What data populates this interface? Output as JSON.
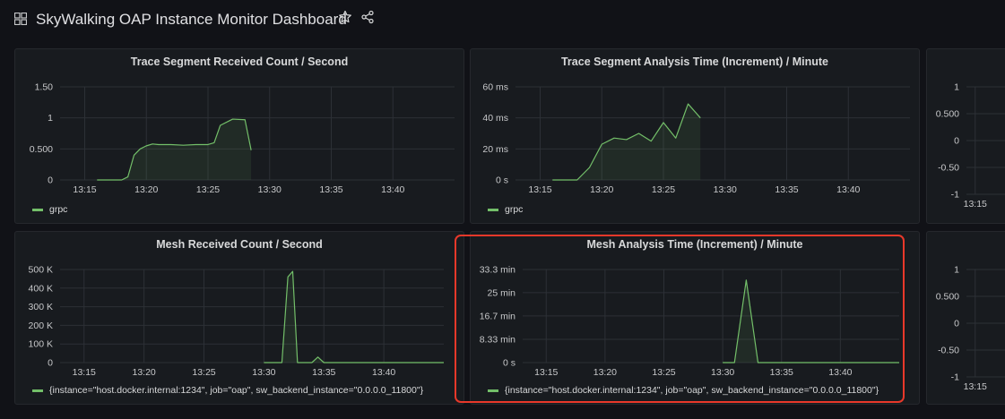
{
  "header": {
    "title": "SkyWalking OAP Instance Monitor Dashboard",
    "icons": [
      "dashboard-grid-icon",
      "star-icon",
      "share-icon"
    ]
  },
  "colors": {
    "series": "#73bf69",
    "highlight": "#e8382a",
    "panel_bg": "#181b1f",
    "page_bg": "#111217"
  },
  "chart_data": [
    {
      "id": "trace-received",
      "type": "area",
      "title": "Trace Segment Received Count / Second",
      "x_ticks": [
        "13:15",
        "13:20",
        "13:25",
        "13:30",
        "13:35",
        "13:40"
      ],
      "y_ticks": [
        "1.50",
        "1",
        "0.500",
        "0"
      ],
      "ylim": [
        0,
        1.5
      ],
      "xlim": [
        "13:13",
        "13:45"
      ],
      "series": [
        {
          "name": "grpc",
          "x": [
            "13:16",
            "13:18",
            "13:18.5",
            "13:19",
            "13:19.5",
            "13:20",
            "13:20.5",
            "13:21",
            "13:22",
            "13:23",
            "13:24",
            "13:25",
            "13:25.5",
            "13:26",
            "13:27",
            "13:28",
            "13:28.5"
          ],
          "y": [
            0,
            0,
            0.05,
            0.4,
            0.5,
            0.55,
            0.58,
            0.57,
            0.57,
            0.56,
            0.57,
            0.57,
            0.6,
            0.88,
            0.98,
            0.97,
            0.48
          ]
        }
      ]
    },
    {
      "id": "trace-analysis",
      "type": "area",
      "title": "Trace Segment Analysis Time (Increment) / Minute",
      "x_ticks": [
        "13:15",
        "13:20",
        "13:25",
        "13:30",
        "13:35",
        "13:40"
      ],
      "y_ticks": [
        "60 ms",
        "40 ms",
        "20 ms",
        "0 s"
      ],
      "ylim": [
        0,
        60
      ],
      "xlim": [
        "13:13",
        "13:45"
      ],
      "series": [
        {
          "name": "grpc",
          "x": [
            "13:16",
            "13:18",
            "13:19",
            "13:20",
            "13:21",
            "13:22",
            "13:23",
            "13:24",
            "13:25",
            "13:26",
            "13:27",
            "13:28"
          ],
          "y": [
            0,
            0,
            8,
            23,
            27,
            26,
            30,
            25,
            37,
            27,
            49,
            40
          ]
        }
      ]
    },
    {
      "id": "mesh-received",
      "type": "area",
      "title": "Mesh Received Count / Second",
      "x_ticks": [
        "13:15",
        "13:20",
        "13:25",
        "13:30",
        "13:35",
        "13:40"
      ],
      "y_ticks": [
        "500 K",
        "400 K",
        "300 K",
        "200 K",
        "100 K",
        "0"
      ],
      "ylim": [
        0,
        500000
      ],
      "xlim": [
        "13:13",
        "13:45"
      ],
      "series": [
        {
          "name": "{instance=\"host.docker.internal:1234\", job=\"oap\", sw_backend_instance=\"0.0.0.0_11800\"}",
          "x": [
            "13:30",
            "13:31.5",
            "13:32",
            "13:32.4",
            "13:32.8",
            "13:34",
            "13:34.5",
            "13:35",
            "13:36",
            "13:45"
          ],
          "y": [
            0,
            0,
            460000,
            490000,
            0,
            0,
            30000,
            0,
            0,
            0
          ]
        }
      ]
    },
    {
      "id": "mesh-analysis",
      "type": "area",
      "title": "Mesh Analysis Time (Increment) / Minute",
      "x_ticks": [
        "13:15",
        "13:20",
        "13:25",
        "13:30",
        "13:35",
        "13:40"
      ],
      "y_ticks": [
        "33.3 min",
        "25 min",
        "16.7 min",
        "8.33 min",
        "0 s"
      ],
      "ylim": [
        0,
        33.3
      ],
      "xlim": [
        "13:13",
        "13:45"
      ],
      "series": [
        {
          "name": "{instance=\"host.docker.internal:1234\", job=\"oap\", sw_backend_instance=\"0.0.0.0_11800\"}",
          "x": [
            "13:30",
            "13:31",
            "13:32",
            "13:33",
            "13:34",
            "13:45"
          ],
          "y": [
            0,
            0,
            29.5,
            0,
            0,
            0
          ]
        }
      ]
    },
    {
      "id": "right-top",
      "type": "line",
      "title": "",
      "x_ticks": [
        "13:15"
      ],
      "y_ticks": [
        "1",
        "0.500",
        "0",
        "-0.50",
        "-1"
      ],
      "ylim": [
        -1,
        1
      ],
      "xlim": [
        "13:13",
        "13:45"
      ],
      "series": []
    },
    {
      "id": "right-bottom",
      "type": "line",
      "title": "",
      "x_ticks": [
        "13:15"
      ],
      "y_ticks": [
        "1",
        "0.500",
        "0",
        "-0.50",
        "-1"
      ],
      "ylim": [
        -1,
        1
      ],
      "xlim": [
        "13:13",
        "13:45"
      ],
      "series": []
    }
  ]
}
